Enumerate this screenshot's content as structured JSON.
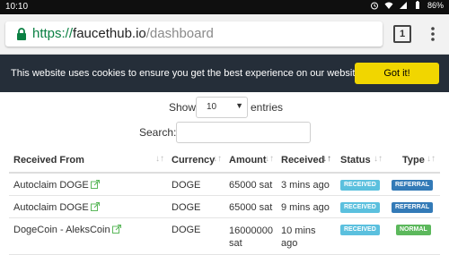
{
  "status_bar": {
    "time": "10:10",
    "battery": "86%"
  },
  "browser": {
    "url_scheme": "https://",
    "url_host": "faucethub.io",
    "url_path": "/dashboard",
    "tab_count": "1"
  },
  "cookie_banner": {
    "message": "This website uses cookies to ensure you get the best experience on our website",
    "button": "Got it!"
  },
  "table_controls": {
    "show_label": "Show",
    "entries_value": "10",
    "entries_label": "entries",
    "search_label": "Search:",
    "search_value": ""
  },
  "table": {
    "headers": [
      "Received From",
      "Currency",
      "Amount",
      "Received",
      "Status",
      "Type"
    ],
    "rows": [
      {
        "from": "Autoclaim DOGE",
        "currency": "DOGE",
        "amount": "65000 sat",
        "received": "3 mins ago",
        "status": "RECEIVED",
        "type": "REFERRAL"
      },
      {
        "from": "Autoclaim DOGE",
        "currency": "DOGE",
        "amount": "65000 sat",
        "received": "9 mins ago",
        "status": "RECEIVED",
        "type": "REFERRAL"
      },
      {
        "from": "DogeCoin - AleksCoin",
        "currency": "DOGE",
        "amount_line1": "16000000",
        "amount_line2": "sat",
        "received_line1": "10 mins",
        "received_line2": "ago",
        "status": "RECEIVED",
        "type": "NORMAL"
      }
    ]
  },
  "colors": {
    "cookie_bg": "#252e39",
    "cookie_button": "#f1d600",
    "url_green": "#0b8043",
    "badge_received": "#5bc0de",
    "badge_referral": "#337ab7",
    "badge_normal": "#5cb85c"
  }
}
